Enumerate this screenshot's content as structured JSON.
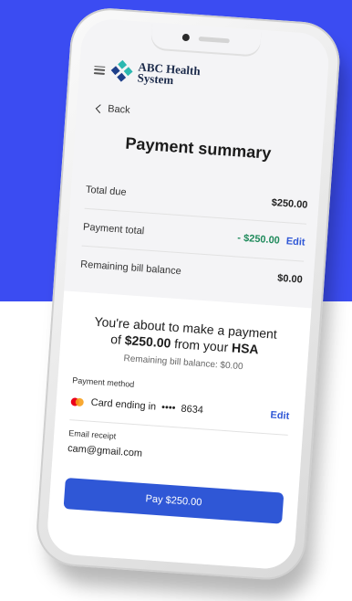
{
  "brand": {
    "name_line1": "ABC Health",
    "name_line2": "System",
    "logo_colors": [
      "#2bb8b0",
      "#1e3f8a",
      "#2bb8b0",
      "#1e3f8a"
    ]
  },
  "nav": {
    "back_label": "Back"
  },
  "page": {
    "title": "Payment summary"
  },
  "summary": {
    "rows": [
      {
        "label": "Total due",
        "value": "$250.00"
      },
      {
        "label": "Payment total",
        "value": "- $250.00",
        "action": "Edit"
      },
      {
        "label": "Remaining bill balance",
        "value": "$0.00"
      }
    ]
  },
  "confirmation": {
    "line1": "You're about to make a payment",
    "line2_prefix": "of ",
    "amount": "$250.00",
    "line2_middle": " from your ",
    "account": "HSA",
    "remaining_text": "Remaining bill balance: $0.00"
  },
  "payment_method": {
    "label": "Payment method",
    "card_text": "Card ending in",
    "card_mask": "••••",
    "card_last4": "8634",
    "edit_label": "Edit",
    "card_colors": [
      "#eb001b",
      "#f79e1b"
    ]
  },
  "email_receipt": {
    "label": "Email receipt",
    "value": "cam@gmail.com"
  },
  "pay_button": {
    "label": "Pay $250.00"
  },
  "colors": {
    "background_blue": "#3b4cf2",
    "primary_button": "#2f57d6",
    "negative_amount": "#1f8a5b"
  }
}
